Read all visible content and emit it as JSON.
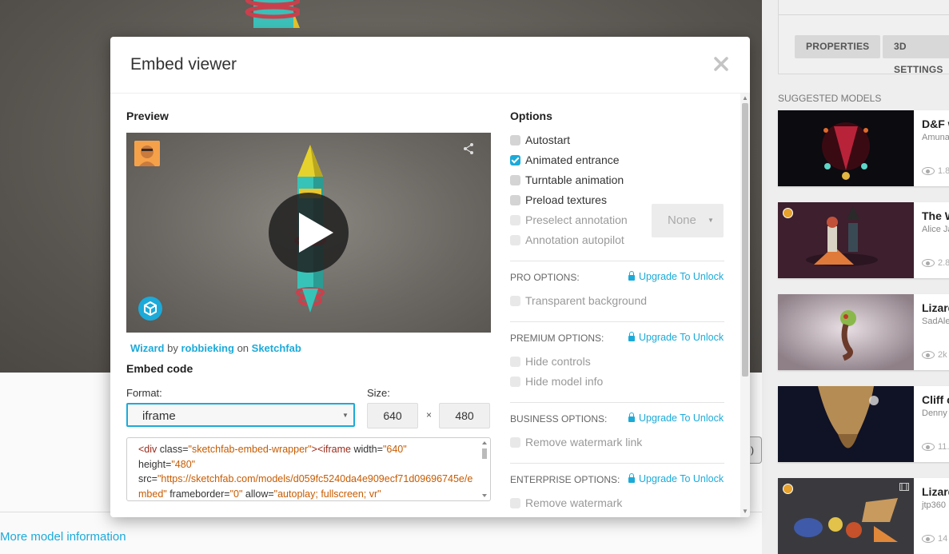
{
  "background": {
    "more_info_link": "More model information",
    "edge_button": ")",
    "tabs": [
      "PROPERTIES",
      "3D SETTINGS"
    ],
    "suggested_heading": "SUGGESTED MODELS",
    "suggested": [
      {
        "title": "D&F w",
        "author": "Amuna",
        "views": "1.8"
      },
      {
        "title": "The W",
        "author": "Alice Ja",
        "views": "2.8"
      },
      {
        "title": "Lizard",
        "author": "SadAle",
        "views": "2k"
      },
      {
        "title": "Cliff c",
        "author": "Denny",
        "views": "11."
      },
      {
        "title": "Lizard",
        "author": "jtp360",
        "views": "14"
      }
    ]
  },
  "modal": {
    "title": "Embed viewer",
    "preview_heading": "Preview",
    "credit": {
      "model": "Wizard",
      "by": "by",
      "author": "robbieking",
      "on": "on",
      "site": "Sketchfab"
    },
    "embed_heading": "Embed code",
    "format_label": "Format:",
    "format_value": "iframe",
    "size_label": "Size:",
    "width": "640",
    "size_separator": "×",
    "height": "480",
    "code": {
      "p1": "<div ",
      "a1": "class=",
      "v1": "\"sketchfab-embed-wrapper\"",
      "p2": "><iframe ",
      "a2": "width=",
      "v2": "\"640\"",
      "a3": " height=",
      "v3": "\"480\"",
      "a4": " src=",
      "v4": "\"https://sketchfab.com/models/d059fc5240da4e909ecf71d09696745e/embed\"",
      "a5": " frameborder=",
      "v5": "\"0\"",
      "a6": " allow=",
      "v6": "\"autoplay; fullscreen; vr\""
    },
    "options_heading": "Options",
    "options": [
      {
        "label": "Autostart",
        "checked": false
      },
      {
        "label": "Animated entrance",
        "checked": true
      },
      {
        "label": "Turntable animation",
        "checked": false
      },
      {
        "label": "Preload textures",
        "checked": false
      },
      {
        "label": "Preselect annotation",
        "checked": false
      },
      {
        "label": "Annotation autopilot",
        "checked": false
      }
    ],
    "annotation_select": "None",
    "upgrade_label": "Upgrade To Unlock",
    "pro": {
      "heading": "PRO OPTIONS:",
      "items": [
        "Transparent background"
      ]
    },
    "premium": {
      "heading": "PREMIUM OPTIONS:",
      "items": [
        "Hide controls",
        "Hide model info"
      ]
    },
    "business": {
      "heading": "BUSINESS OPTIONS:",
      "items": [
        "Remove watermark link"
      ]
    },
    "enterprise": {
      "heading": "ENTERPRISE OPTIONS:",
      "items": [
        "Remove watermark"
      ]
    },
    "accent_color": "#1caad9"
  }
}
